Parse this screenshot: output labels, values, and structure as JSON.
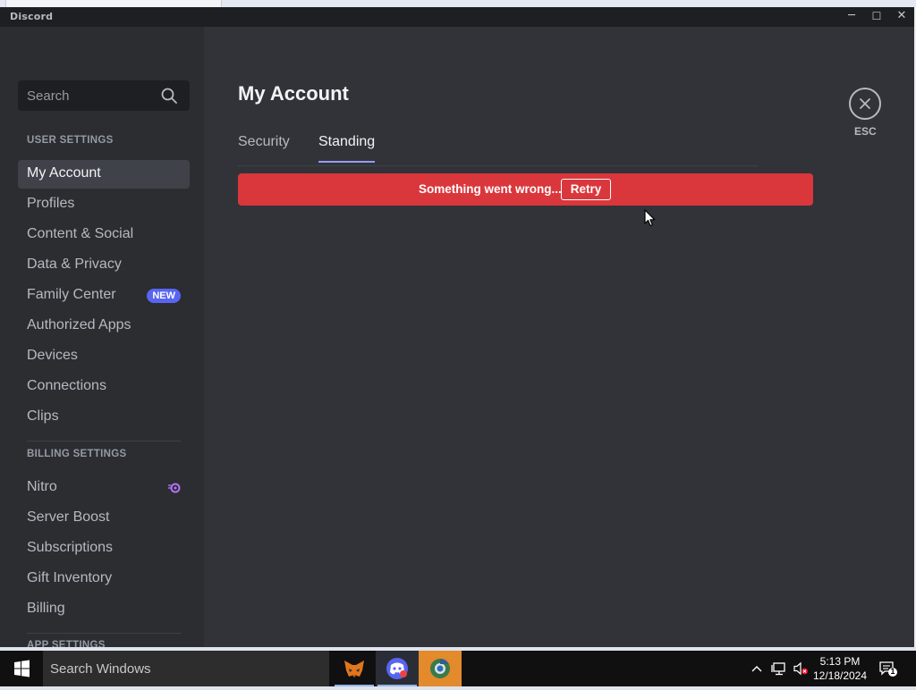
{
  "window": {
    "title": "Discord",
    "minimize": "─",
    "maximize": "☐",
    "close": "✕"
  },
  "sidebar": {
    "search_placeholder": "Search",
    "user_settings_header": "USER SETTINGS",
    "user_items": [
      {
        "label": "My Account",
        "active": true
      },
      {
        "label": "Profiles"
      },
      {
        "label": "Content & Social"
      },
      {
        "label": "Data & Privacy"
      },
      {
        "label": "Family Center",
        "badge": "NEW"
      },
      {
        "label": "Authorized Apps"
      },
      {
        "label": "Devices"
      },
      {
        "label": "Connections"
      },
      {
        "label": "Clips"
      }
    ],
    "billing_settings_header": "BILLING SETTINGS",
    "billing_items": [
      {
        "label": "Nitro"
      },
      {
        "label": "Server Boost"
      },
      {
        "label": "Subscriptions"
      },
      {
        "label": "Gift Inventory"
      },
      {
        "label": "Billing"
      }
    ],
    "app_settings_header": "APP SETTINGS"
  },
  "main": {
    "title": "My Account",
    "tabs": [
      {
        "label": "Security",
        "active": false
      },
      {
        "label": "Standing",
        "active": true
      }
    ],
    "error": {
      "message": "Something went wrong...",
      "retry": "Retry"
    },
    "close_label": "ESC"
  },
  "taskbar": {
    "search_placeholder": "Search Windows",
    "time": "5:13 PM",
    "date": "12/18/2024",
    "notification_count": "1"
  },
  "colors": {
    "accent": "#5865f2",
    "error": "#da373c",
    "sidebar_bg": "#2b2d31",
    "main_bg": "#313338",
    "tab_indicator": "#949cf7"
  }
}
